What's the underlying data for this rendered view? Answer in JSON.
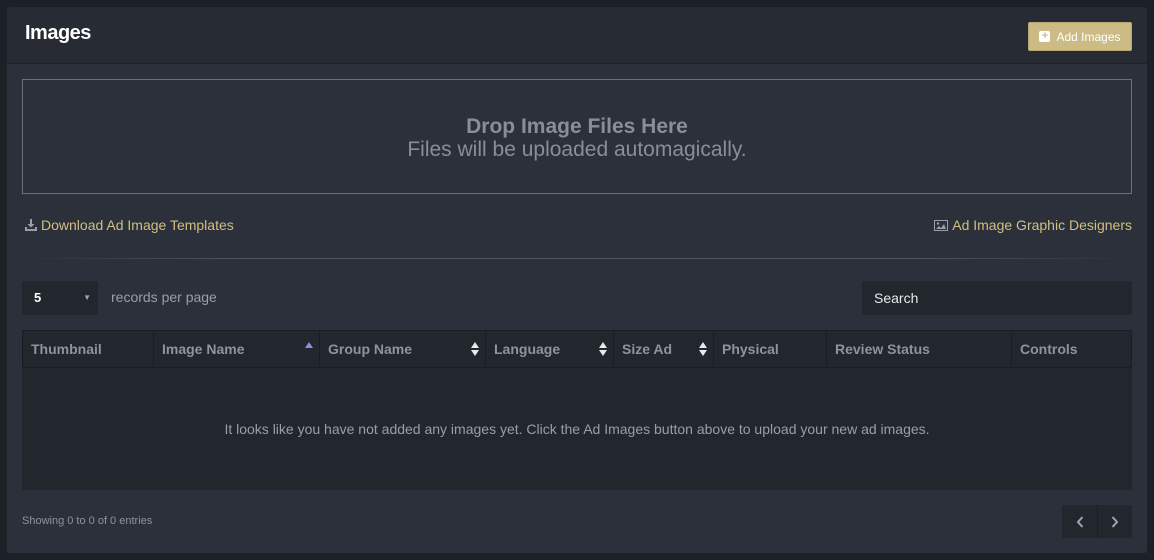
{
  "header": {
    "title": "Images",
    "add_button_label": "Add Images"
  },
  "dropzone": {
    "title": "Drop Image Files Here",
    "subtitle": "Files will be uploaded automagically."
  },
  "links": {
    "download_templates": "Download Ad Image Templates",
    "graphic_designers": "Ad Image Graphic Designers"
  },
  "table_controls": {
    "page_size": "5",
    "records_label": "records per page",
    "search_placeholder": "Search"
  },
  "table": {
    "columns": [
      "Thumbnail",
      "Image Name",
      "Group Name",
      "Language",
      "Size Ad",
      "Physical",
      "Review Status",
      "Controls"
    ],
    "empty_message": "It looks like you have not added any images yet. Click the Ad Images button above to upload your new ad images."
  },
  "footer": {
    "showing": "Showing 0 to 0 of 0 entries"
  },
  "colors": {
    "accent": "#cdbb85",
    "link": "#d3bf82",
    "panel_bg": "#2b303a",
    "sort_active": "#8a8ce6"
  },
  "icons": {
    "add": "plus-square-icon",
    "download": "download-icon",
    "designers": "image-icon",
    "sort_active": "sort-asc-icon",
    "sort": "sort-icon",
    "prev": "chevron-left-icon",
    "next": "chevron-right-icon",
    "select_caret": "caret-down-icon"
  }
}
